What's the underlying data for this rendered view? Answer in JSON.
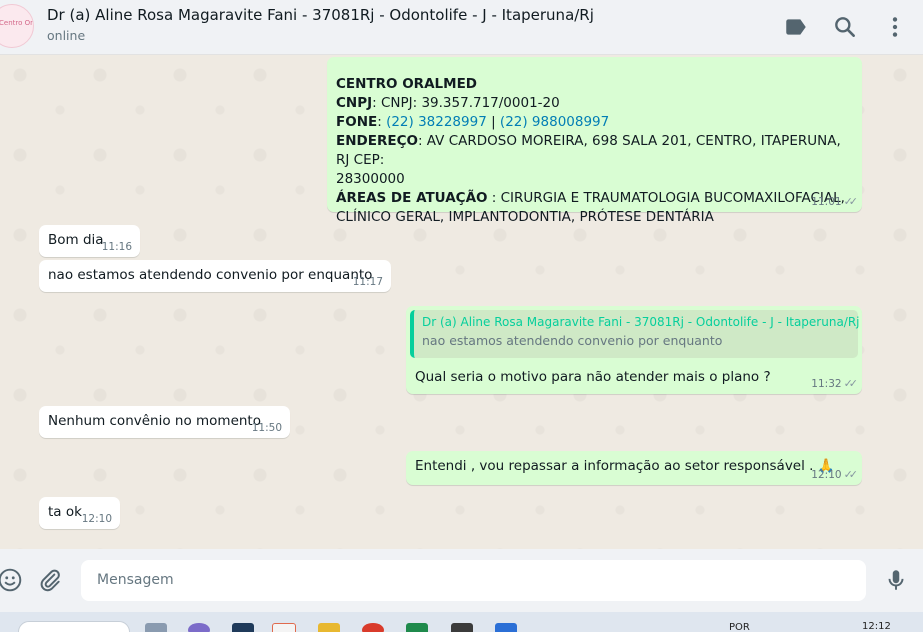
{
  "header": {
    "avatar_text": "Centro Oralmed",
    "title": "Dr (a) Aline Rosa Magaravite Fani - 37081Rj - Odontolife - J - Itaperuna/Rj",
    "status": "online"
  },
  "messages": [
    {
      "direction": "out",
      "company": "CENTRO ORALMED",
      "cnpj_label": "CNPJ",
      "cnpj_value": ": CNPJ: 39.357.717/0001-20",
      "fone_label": "FONE",
      "fone_sep": ": ",
      "phone1": "(22) 38228997",
      "phone_divider": " | ",
      "phone2": "(22) 988008997",
      "endereco_label": "ENDEREÇO",
      "endereco_value1": ": AV CARDOSO MOREIRA, 698 SALA 201, CENTRO, ITAPERUNA, RJ CEP:",
      "endereco_value2": "28300000",
      "areas_label": "ÁREAS DE ATUAÇÃO",
      "areas_value1": " : CIRURGIA E TRAUMATOLOGIA BUCOMAXILOFACIAL,",
      "areas_value2": "CLÍNICO GERAL, IMPLANTODONTIA, PRÓTESE DENTÁRIA",
      "time": "11:01"
    },
    {
      "direction": "in",
      "text": "Bom dia",
      "time": "11:16"
    },
    {
      "direction": "in",
      "text": "nao estamos atendendo convenio por enquanto",
      "time": "11:17"
    },
    {
      "direction": "out",
      "quote_name": "Dr (a) Aline Rosa Magaravite Fani - 37081Rj - Odontolife - J - Itaperuna/Rj",
      "quote_text": "nao estamos atendendo convenio por enquanto",
      "text": "Qual seria o motivo para não atender mais o plano ?",
      "time": "11:32"
    },
    {
      "direction": "in",
      "text": "Nenhum convênio no momento",
      "time": "11:50"
    },
    {
      "direction": "out",
      "text": "Entendi , vou repassar a informação ao setor responsável . 🙏",
      "time": "12:10"
    },
    {
      "direction": "in",
      "text": "ta ok",
      "time": "12:10"
    }
  ],
  "compose": {
    "placeholder": "Mensagem"
  },
  "taskbar": {
    "lang": "POR",
    "clock": "12:12"
  },
  "icons": [
    "label-icon",
    "search-icon",
    "menu-icon",
    "emoji-icon",
    "attach-icon",
    "mic-icon"
  ],
  "colors": {
    "outgoing": "#d9fdd3",
    "incoming": "#ffffff",
    "link": "#027eb5",
    "quote_accent": "#06cf9c"
  }
}
